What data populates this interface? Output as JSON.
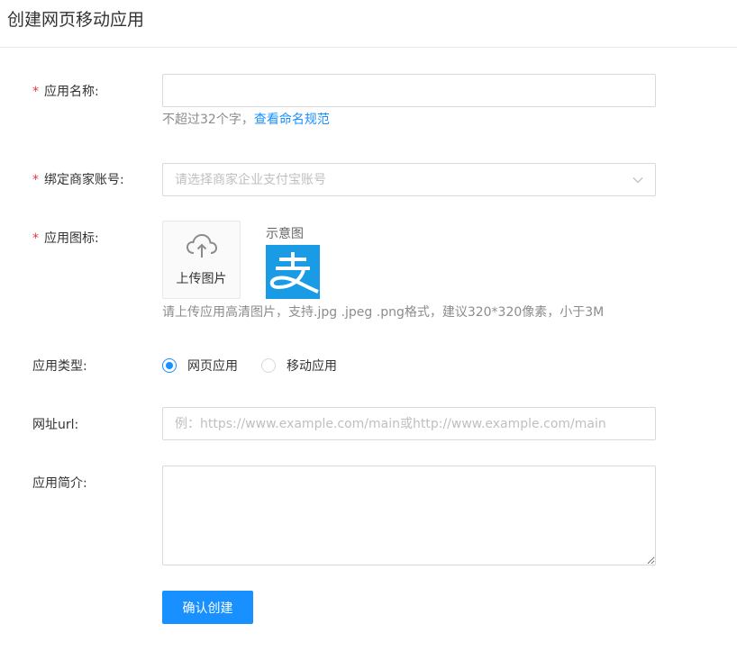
{
  "page": {
    "title": "创建网页移动应用"
  },
  "form": {
    "app_name": {
      "required_mark": "*",
      "label": "应用名称:",
      "value": "",
      "hint_text": "不超过32个字，",
      "hint_link": "查看命名规范"
    },
    "merchant_account": {
      "required_mark": "*",
      "label": "绑定商家账号:",
      "placeholder": "请选择商家企业支付宝账号",
      "arrow_icon": "chevron-down-icon"
    },
    "app_icon": {
      "required_mark": "*",
      "label": "应用图标:",
      "upload_icon": "cloud-upload-icon",
      "upload_label": "上传图片",
      "sample_label": "示意图",
      "sample_logo_text": "支",
      "sample_logo_color": "#1a9be6",
      "hint": "请上传应用高清图片，支持.jpg .jpeg .png格式，建议320*320像素，小于3M"
    },
    "app_type": {
      "label": "应用类型:",
      "options": [
        {
          "label": "网页应用",
          "checked": true
        },
        {
          "label": "移动应用",
          "checked": false
        }
      ]
    },
    "url": {
      "label": "网址url:",
      "placeholder": "例：https://www.example.com/main或http://www.example.com/main"
    },
    "description": {
      "label": "应用简介:",
      "value": ""
    },
    "submit_label": "确认创建"
  },
  "colors": {
    "primary": "#1890ff",
    "required": "#e4393c",
    "border": "#d9d9d9"
  }
}
